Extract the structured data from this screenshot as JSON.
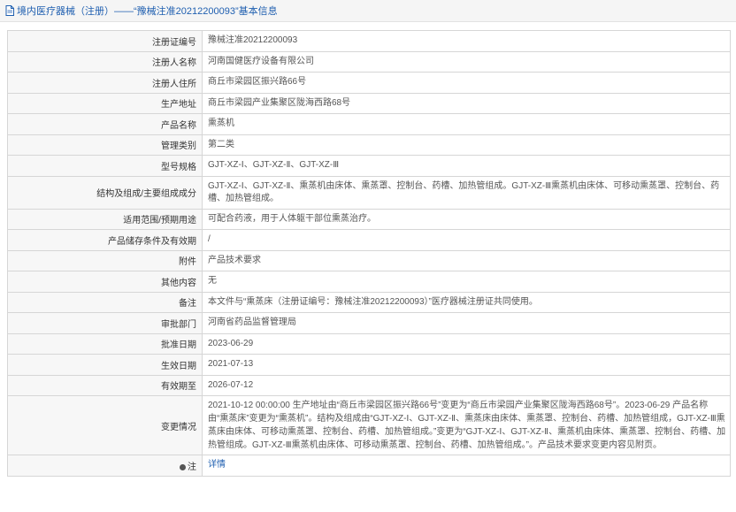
{
  "header": {
    "title": "境内医疗器械（注册）——“豫械注准20212200093”基本信息"
  },
  "rows": [
    {
      "label": "注册证编号",
      "value": "豫械注准20212200093"
    },
    {
      "label": "注册人名称",
      "value": "河南国健医疗设备有限公司"
    },
    {
      "label": "注册人住所",
      "value": "商丘市梁园区振兴路66号"
    },
    {
      "label": "生产地址",
      "value": "商丘市梁园产业集聚区陇海西路68号"
    },
    {
      "label": "产品名称",
      "value": "熏蒸机"
    },
    {
      "label": "管理类别",
      "value": "第二类"
    },
    {
      "label": "型号规格",
      "value": "GJT-XZ-Ⅰ、GJT-XZ-Ⅱ、GJT-XZ-Ⅲ"
    },
    {
      "label": "结构及组成/主要组成成分",
      "value": "GJT-XZ-Ⅰ、GJT-XZ-Ⅱ、熏蒸机由床体、熏蒸罩、控制台、药槽、加热管组成。GJT-XZ-Ⅲ熏蒸机由床体、可移动熏蒸罩、控制台、药槽、加热管组成。"
    },
    {
      "label": "适用范围/预期用途",
      "value": "可配合药液，用于人体躯干部位熏蒸治疗。"
    },
    {
      "label": "产品储存条件及有效期",
      "value": "/"
    },
    {
      "label": "附件",
      "value": "产品技术要求"
    },
    {
      "label": "其他内容",
      "value": "无"
    },
    {
      "label": "备注",
      "value": "本文件与“熏蒸床（注册证编号：豫械注准20212200093）”医疗器械注册证共同使用。"
    },
    {
      "label": "审批部门",
      "value": "河南省药品监督管理局"
    },
    {
      "label": "批准日期",
      "value": "2023-06-29"
    },
    {
      "label": "生效日期",
      "value": "2021-07-13"
    },
    {
      "label": "有效期至",
      "value": "2026-07-12"
    },
    {
      "label": "变更情况",
      "value": "2021-10-12 00:00:00 生产地址由“商丘市梁园区振兴路66号”变更为“商丘市梁园产业集聚区陇海西路68号”。2023-06-29 产品名称由“熏蒸床”变更为“熏蒸机”。结构及组成由“GJT-XZ-Ⅰ、GJT-XZ-Ⅱ、熏蒸床由床体、熏蒸罩、控制台、药槽、加热管组成，GJT-XZ-Ⅲ熏蒸床由床体、可移动熏蒸罩、控制台、药槽、加热管组成。”变更为“GJT-XZ-Ⅰ、GJT-XZ-Ⅱ、熏蒸机由床体、熏蒸罩、控制台、药槽、加热管组成。GJT-XZ-Ⅲ熏蒸机由床体、可移动熏蒸罩、控制台、药槽、加热管组成。”。产品技术要求变更内容见附页。"
    },
    {
      "label": "注",
      "value": "详情"
    }
  ]
}
